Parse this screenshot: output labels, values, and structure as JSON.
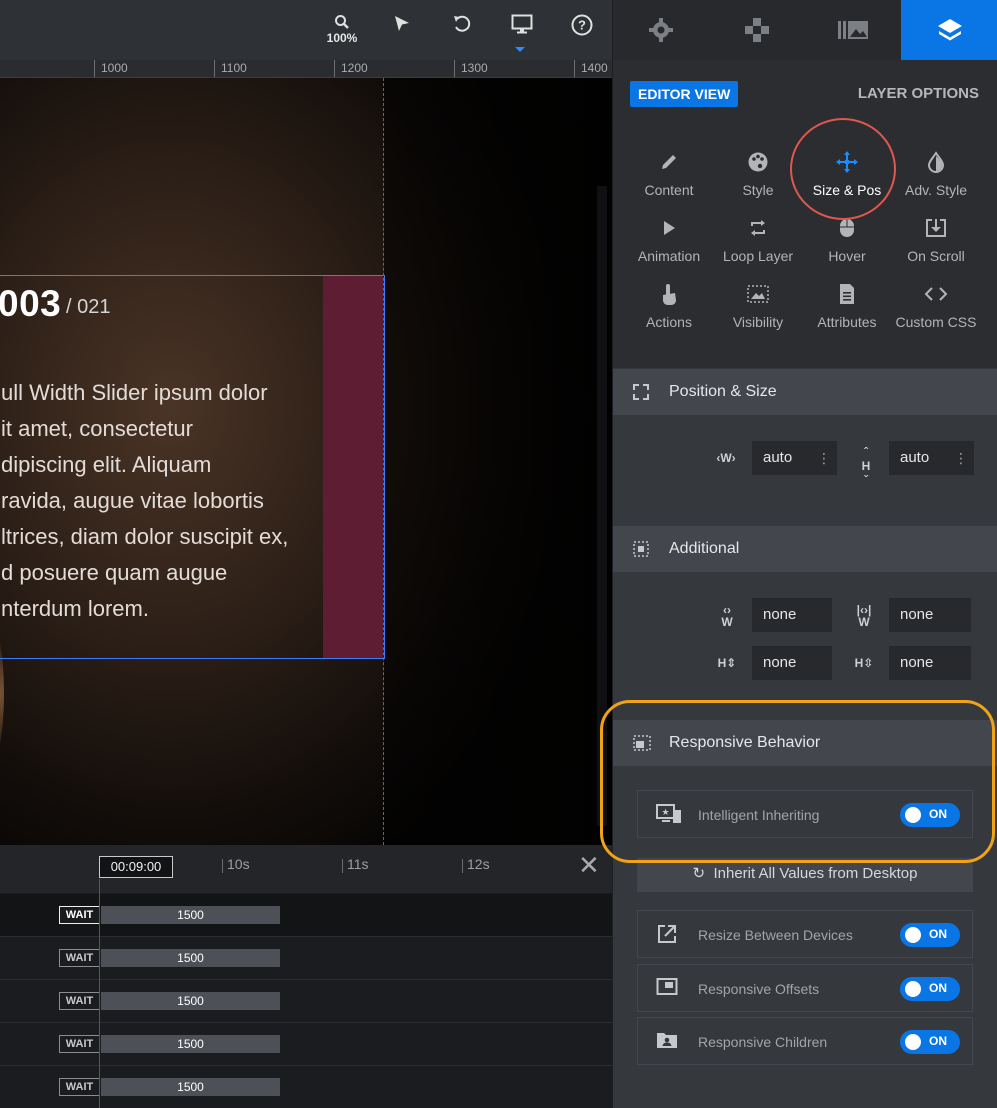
{
  "toolbar": {
    "zoom": "100%",
    "icons": [
      "zoom-icon",
      "cursor-arrow-icon",
      "undo-icon",
      "desktop-icon",
      "help-icon"
    ]
  },
  "ruler": {
    "labels": [
      "1000",
      "1100",
      "1200",
      "1300",
      "1400"
    ]
  },
  "canvas": {
    "slide_number": "003",
    "slide_total": "/ 021",
    "paragraph_lines": [
      "ull Width Slider ipsum dolor",
      "it amet, consectetur",
      "dipiscing elit. Aliquam",
      "ravida, augue vitae lobortis",
      "ltrices, diam dolor suscipit ex,",
      "d posuere quam augue",
      "nterdum lorem."
    ]
  },
  "timeline": {
    "current_time": "00:09:00",
    "markers": [
      "10s",
      "11s",
      "12s"
    ],
    "rows": [
      {
        "wait": "WAIT",
        "duration": "1500"
      },
      {
        "wait": "WAIT",
        "duration": "1500"
      },
      {
        "wait": "WAIT",
        "duration": "1500"
      },
      {
        "wait": "WAIT",
        "duration": "1500"
      },
      {
        "wait": "WAIT",
        "duration": "1500"
      }
    ]
  },
  "panel": {
    "tabs": [
      "gear-icon",
      "puzzle-icon",
      "media-library-icon",
      "layers-icon"
    ],
    "active_tab": "layers-icon",
    "editor_view": "EDITOR VIEW",
    "layer_options": "LAYER OPTIONS",
    "categories": [
      {
        "label": "Content",
        "icon": "pencil-icon"
      },
      {
        "label": "Style",
        "icon": "palette-icon"
      },
      {
        "label": "Size & Pos",
        "icon": "move-arrows-icon"
      },
      {
        "label": "Adv. Style",
        "icon": "drop-icon"
      },
      {
        "label": "Animation",
        "icon": "play-icon"
      },
      {
        "label": "Loop Layer",
        "icon": "loop-icon"
      },
      {
        "label": "Hover",
        "icon": "mouse-icon"
      },
      {
        "label": "On Scroll",
        "icon": "scroll-down-icon"
      },
      {
        "label": "Actions",
        "icon": "hand-pointer-icon"
      },
      {
        "label": "Visibility",
        "icon": "visibility-icon"
      },
      {
        "label": "Attributes",
        "icon": "document-icon"
      },
      {
        "label": "Custom CSS",
        "icon": "code-icon"
      }
    ],
    "active_category": "Size & Pos",
    "position_size": {
      "title": "Position & Size",
      "width_label": "W",
      "height_label": "H",
      "width": "auto",
      "height": "auto"
    },
    "additional": {
      "title": "Additional",
      "min_width_label": "W",
      "max_width_label": "W",
      "min_height_label": "H",
      "max_height_label": "H",
      "min_width": "none",
      "max_width": "none",
      "min_height": "none",
      "max_height": "none"
    },
    "responsive": {
      "title": "Responsive Behavior",
      "intelligent_inheriting": {
        "label": "Intelligent Inheriting",
        "state": "ON"
      },
      "inherit_button": "Inherit All Values from Desktop",
      "resize_between_devices": {
        "label": "Resize Between Devices",
        "state": "ON"
      },
      "responsive_offsets": {
        "label": "Responsive Offsets",
        "state": "ON"
      },
      "responsive_children": {
        "label": "Responsive Children",
        "state": "ON"
      }
    },
    "colors": {
      "accent": "#0a76e6",
      "highlight_circle": "#e0574f",
      "callout": "#f0a316"
    }
  }
}
